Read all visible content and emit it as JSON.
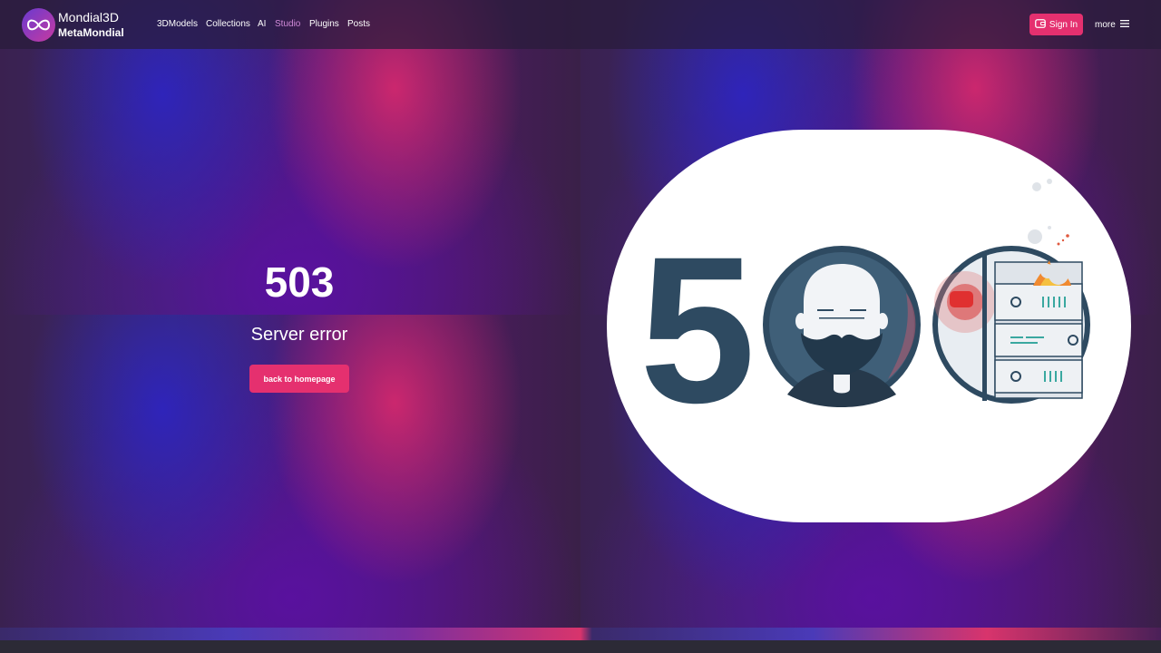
{
  "brand": {
    "title": "Mondial3D",
    "subtitle": "MetaMondial",
    "logo_icon": "infinity-logo-icon"
  },
  "nav": {
    "links": [
      {
        "label": "3DModels",
        "active": false
      },
      {
        "label": "Collections",
        "active": false
      },
      {
        "label": "AI",
        "active": false
      },
      {
        "label": "Studio",
        "active": true
      },
      {
        "label": "Plugins",
        "active": false
      },
      {
        "label": "Posts",
        "active": false
      }
    ],
    "signin_label": "Sign In",
    "signin_icon": "wallet-icon",
    "more_label": "more",
    "more_icon": "hamburger-menu-icon"
  },
  "error": {
    "code": "503",
    "message": "Server error",
    "button_label": "back to homepage"
  },
  "illustration": {
    "digit": "5",
    "description_icons": [
      "bearded-man-icon",
      "burning-server-icon"
    ]
  },
  "colors": {
    "accent": "#e5306f",
    "nav_active": "#d08ad8",
    "illustration_dark": "#2e4a61"
  }
}
